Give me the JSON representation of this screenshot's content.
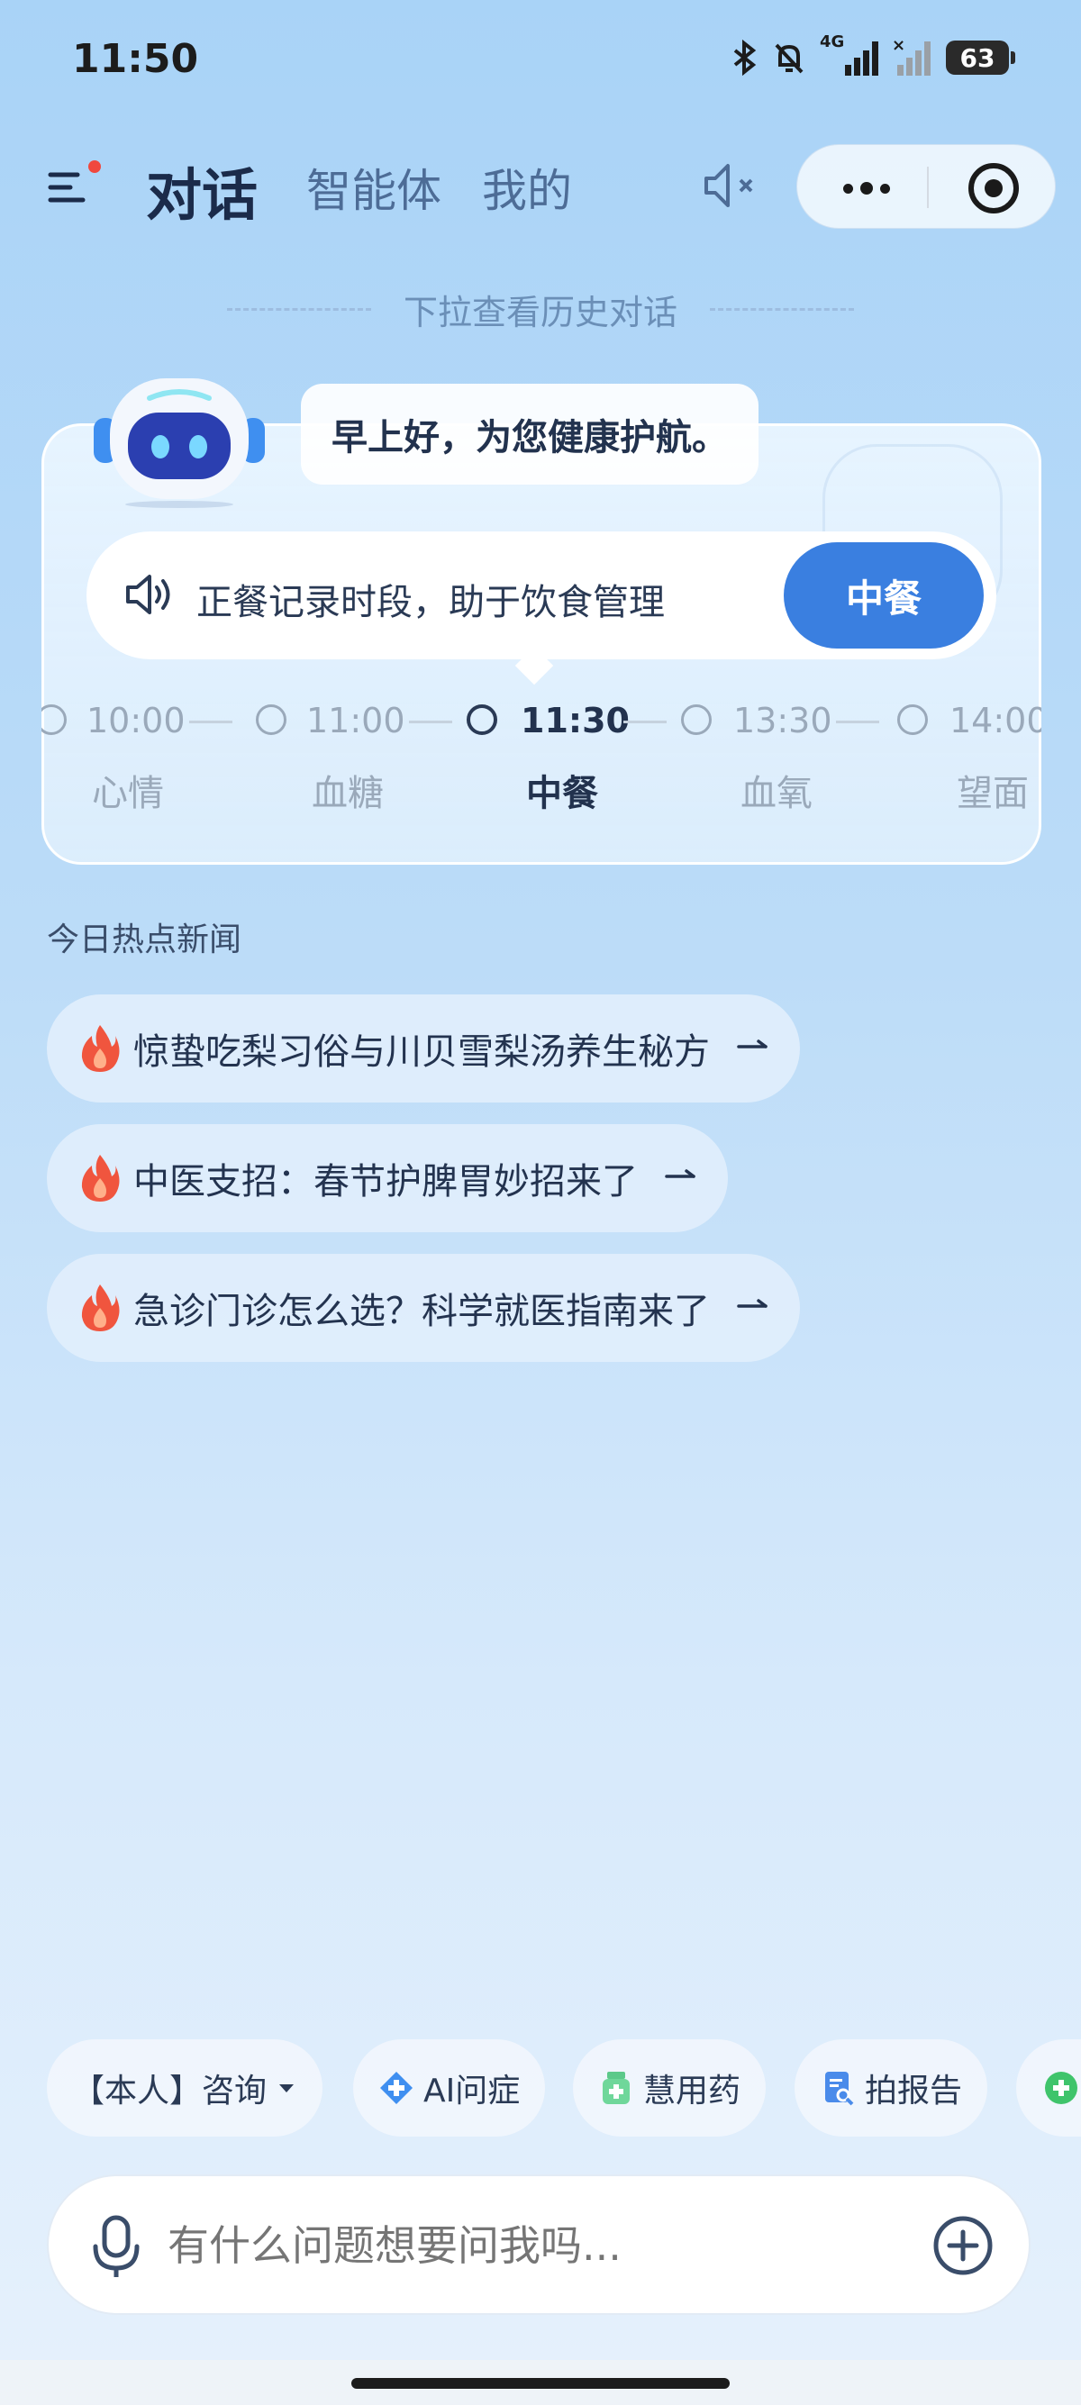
{
  "status_bar": {
    "time": "11:50",
    "network": "4G",
    "battery": "63"
  },
  "nav": {
    "tabs": [
      {
        "label": "对话",
        "active": true
      },
      {
        "label": "智能体",
        "active": false
      },
      {
        "label": "我的",
        "active": false
      }
    ]
  },
  "pull_hint": "下拉查看历史对话",
  "greeting": "早上好，为您健康护航。",
  "notice": {
    "text": "正餐记录时段，助于饮食管理",
    "button": "中餐"
  },
  "timeline": [
    {
      "time": "10:00",
      "label": "心情",
      "active": false
    },
    {
      "time": "11:00",
      "label": "血糖",
      "active": false
    },
    {
      "time": "11:30",
      "label": "中餐",
      "active": true
    },
    {
      "time": "13:30",
      "label": "血氧",
      "active": false
    },
    {
      "time": "14:00",
      "label": "望面",
      "active": false
    }
  ],
  "news": {
    "title": "今日热点新闻",
    "items": [
      "惊蛰吃梨习俗与川贝雪梨汤养生秘方",
      "中医支招：春节护脾胃妙招来了",
      "急诊门诊怎么选？科学就医指南来了"
    ]
  },
  "shortcuts": [
    {
      "label": "【本人】咨询",
      "icon": "chevron-down-icon"
    },
    {
      "label": "AI问症",
      "icon": "medical-cross-icon"
    },
    {
      "label": "慧用药",
      "icon": "medicine-bottle-icon"
    },
    {
      "label": "拍报告",
      "icon": "report-scan-icon"
    }
  ],
  "input": {
    "placeholder": "有什么问题想要问我吗..."
  },
  "colors": {
    "accent": "#3a7fe0",
    "fire": "#f0553e",
    "badge_dot": "#f0483e"
  }
}
